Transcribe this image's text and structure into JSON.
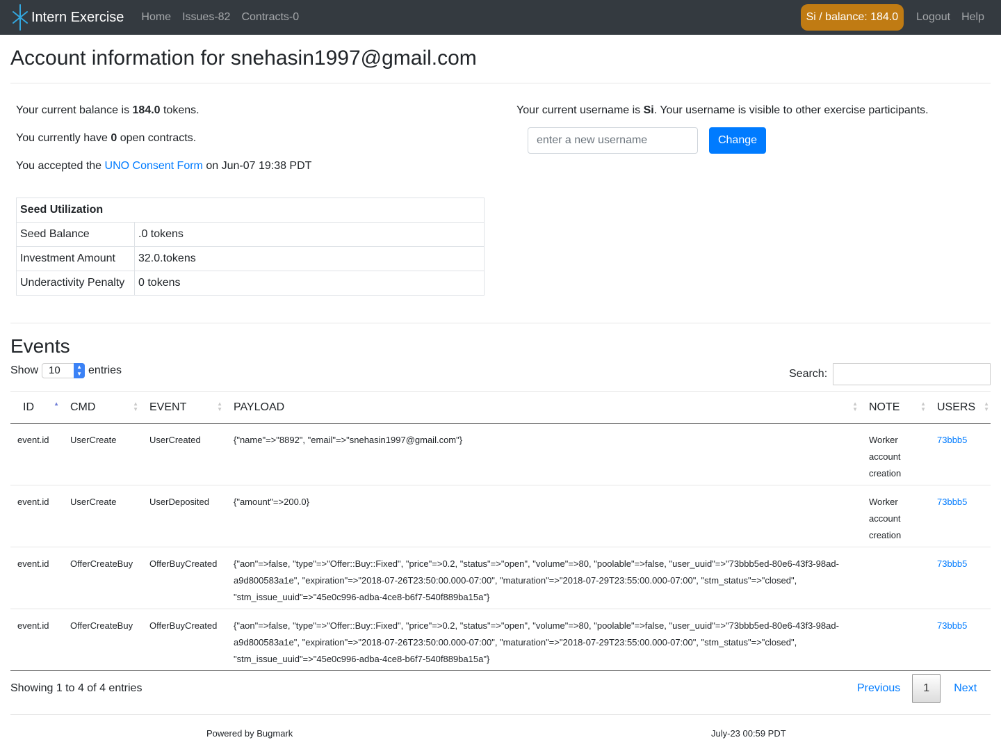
{
  "navbar": {
    "brand": "Intern Exercise",
    "links": [
      "Home",
      "Issues-82",
      "Contracts-0"
    ],
    "balance_pill": "Si / balance: 184.0",
    "logout": "Logout",
    "help": "Help",
    "colors": {
      "background": "#343a40",
      "pill": "#c07b13"
    }
  },
  "page_title": "Account information for snehasin1997@gmail.com",
  "account": {
    "balance_prefix": "Your current balance is ",
    "balance_value": "184.0",
    "balance_suffix": " tokens.",
    "contracts_prefix": "You currently have ",
    "contracts_value": "0",
    "contracts_suffix": " open contracts.",
    "consent_prefix": "You accepted the ",
    "consent_link": "UNO Consent Form",
    "consent_suffix": " on Jun-07 19:38 PDT"
  },
  "seed_table": {
    "title": "Seed Utilization",
    "rows": [
      {
        "label": "Seed Balance",
        "value": ".0 tokens"
      },
      {
        "label": "Investment Amount",
        "value": "32.0.tokens"
      },
      {
        "label": "Underactivity Penalty",
        "value": "0 tokens"
      }
    ]
  },
  "username": {
    "prefix": "Your current username is ",
    "value": "Si",
    "suffix": ". Your username is visible to other exercise participants.",
    "placeholder": "enter a new username",
    "button": "Change"
  },
  "events": {
    "title": "Events",
    "show_label": "Show",
    "show_value": "10",
    "entries_label": "entries",
    "search_label": "Search:",
    "columns": [
      "ID",
      "CMD",
      "EVENT",
      "PAYLOAD",
      "NOTE",
      "USERS"
    ],
    "rows": [
      {
        "id": "event.id",
        "cmd": "UserCreate",
        "event": "UserCreated",
        "payload": "{\"name\"=>\"8892\", \"email\"=>\"snehasin1997@gmail.com\"}",
        "note": "Worker account creation",
        "users": "73bbb5"
      },
      {
        "id": "event.id",
        "cmd": "UserCreate",
        "event": "UserDeposited",
        "payload": "{\"amount\"=>200.0}",
        "note": "Worker account creation",
        "users": "73bbb5"
      },
      {
        "id": "event.id",
        "cmd": "OfferCreateBuy",
        "event": "OfferBuyCreated",
        "payload": "{\"aon\"=>false, \"type\"=>\"Offer::Buy::Fixed\", \"price\"=>0.2, \"status\"=>\"open\", \"volume\"=>80, \"poolable\"=>false, \"user_uuid\"=>\"73bbb5ed-80e6-43f3-98ad-a9d800583a1e\", \"expiration\"=>\"2018-07-26T23:50:00.000-07:00\", \"maturation\"=>\"2018-07-29T23:55:00.000-07:00\", \"stm_status\"=>\"closed\", \"stm_issue_uuid\"=>\"45e0c996-adba-4ce8-b6f7-540f889ba15a\"}",
        "note": "",
        "users": "73bbb5"
      },
      {
        "id": "event.id",
        "cmd": "OfferCreateBuy",
        "event": "OfferBuyCreated",
        "payload": "{\"aon\"=>false, \"type\"=>\"Offer::Buy::Fixed\", \"price\"=>0.2, \"status\"=>\"open\", \"volume\"=>80, \"poolable\"=>false, \"user_uuid\"=>\"73bbb5ed-80e6-43f3-98ad-a9d800583a1e\", \"expiration\"=>\"2018-07-26T23:50:00.000-07:00\", \"maturation\"=>\"2018-07-29T23:55:00.000-07:00\", \"stm_status\"=>\"closed\", \"stm_issue_uuid\"=>\"45e0c996-adba-4ce8-b6f7-540f889ba15a\"}",
        "note": "",
        "users": "73bbb5"
      }
    ],
    "showing": "Showing 1 to 4 of 4 entries",
    "pager": {
      "previous": "Previous",
      "page": "1",
      "next": "Next"
    }
  },
  "footer": {
    "powered_by": "Powered by Bugmark",
    "timestamp": "July-23 00:59 PDT"
  }
}
